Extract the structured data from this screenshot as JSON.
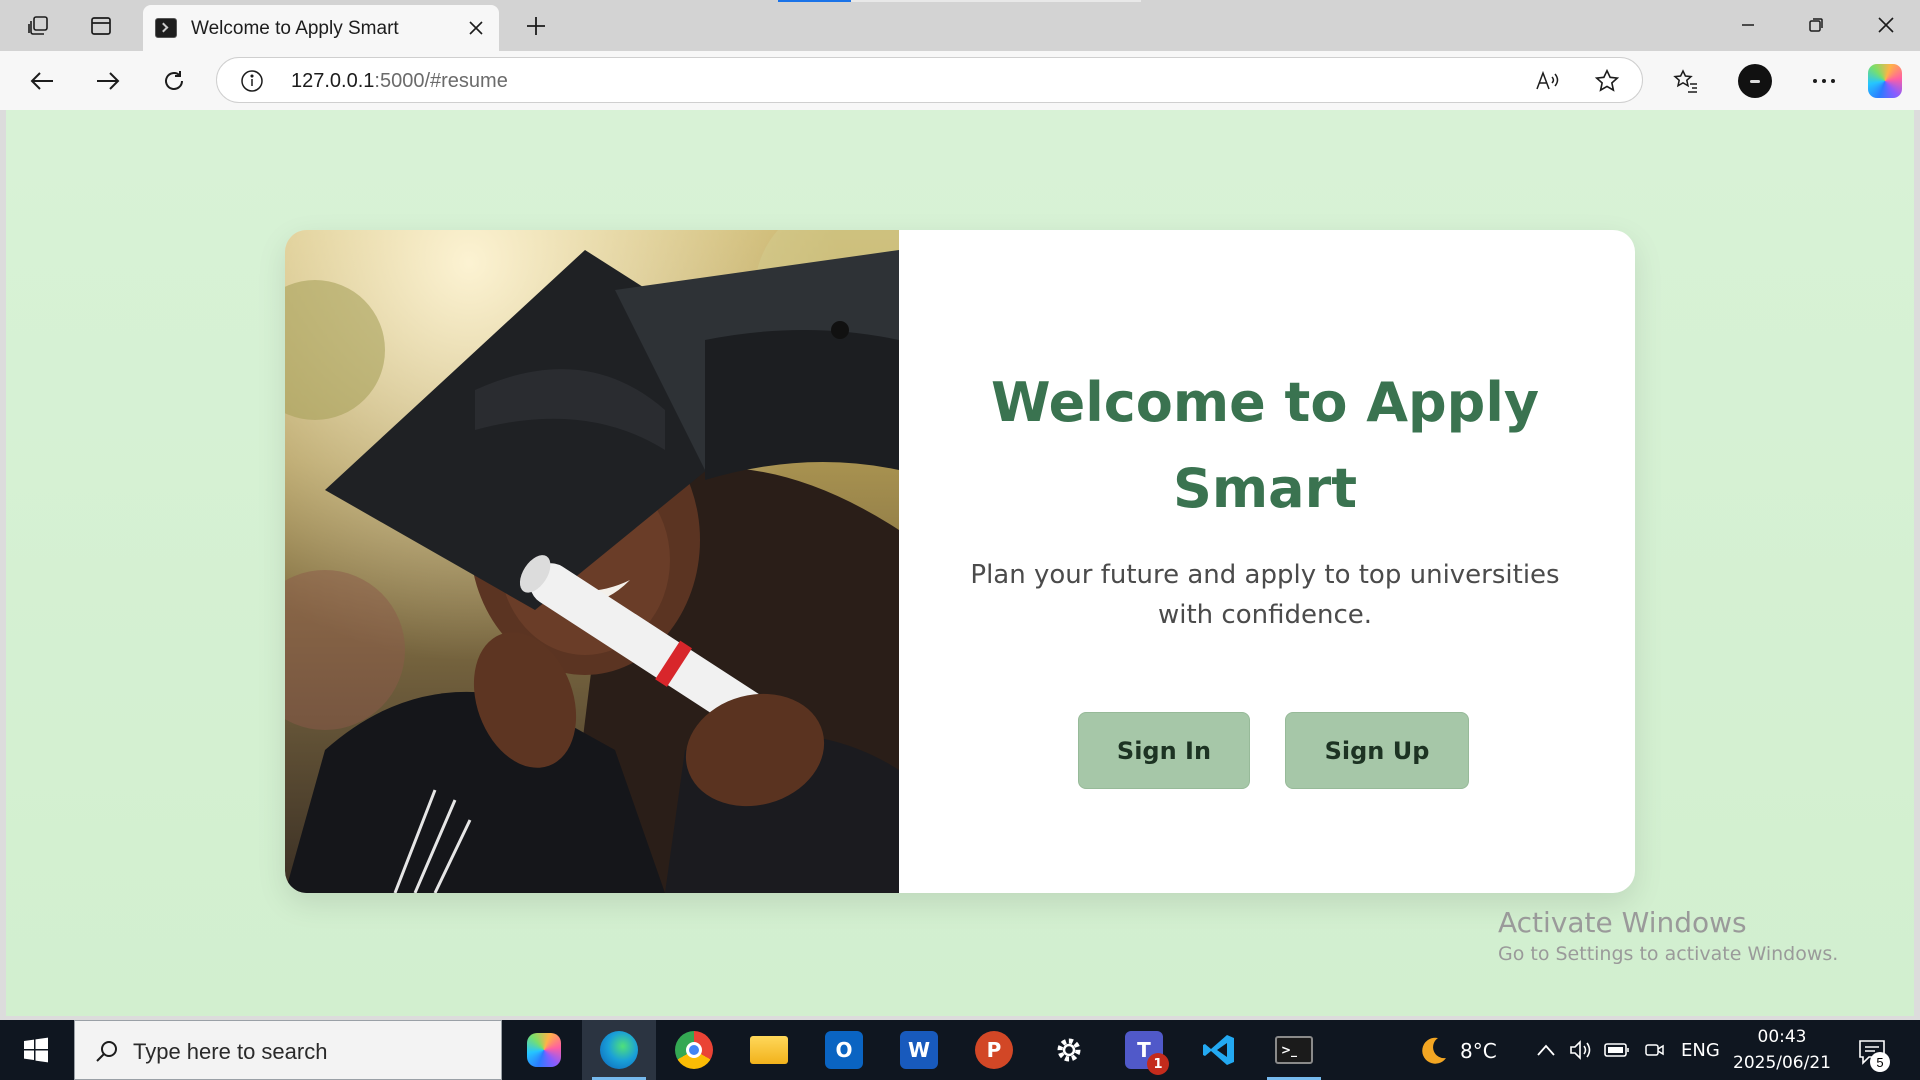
{
  "browser": {
    "tab": {
      "title": "Welcome to Apply Smart",
      "favicon": "terminal-favicon"
    },
    "address": {
      "host": "127.0.0.1",
      "rest": ":5000/#resume"
    },
    "icons": [
      "workspaces-icon",
      "vertical-tabs-icon",
      "close-icon",
      "plus-icon",
      "minimize-icon",
      "restore-icon",
      "close-window-icon",
      "back-icon",
      "forward-icon",
      "refresh-icon",
      "info-icon",
      "read-aloud-icon",
      "star-icon",
      "favorites-icon",
      "more-icon",
      "copilot-icon"
    ]
  },
  "page": {
    "heading": "Welcome to Apply Smart",
    "tagline": "Plan your future and apply to top universities with confidence.",
    "buttons": {
      "signin": "Sign In",
      "signup": "Sign Up"
    },
    "colors": {
      "background": "#d6f0d3",
      "heading": "#3a7350",
      "button": "#a6c7a8"
    }
  },
  "watermark": {
    "line1": "Activate Windows",
    "line2": "Go to Settings to activate Windows."
  },
  "taskbar": {
    "search_placeholder": "Type here to search",
    "apps": [
      "copilot-app",
      "edge-app",
      "chrome-app",
      "file-explorer-app",
      "outlook-app",
      "word-app",
      "powerpoint-app",
      "settings-app",
      "teams-app",
      "vscode-app",
      "terminal-app"
    ],
    "teams_badge": "1",
    "weather": {
      "temp": "8°C",
      "icon": "moon-icon"
    },
    "lang": "ENG",
    "time": "00:43",
    "date": "2025/06/21",
    "notifications": "5"
  }
}
